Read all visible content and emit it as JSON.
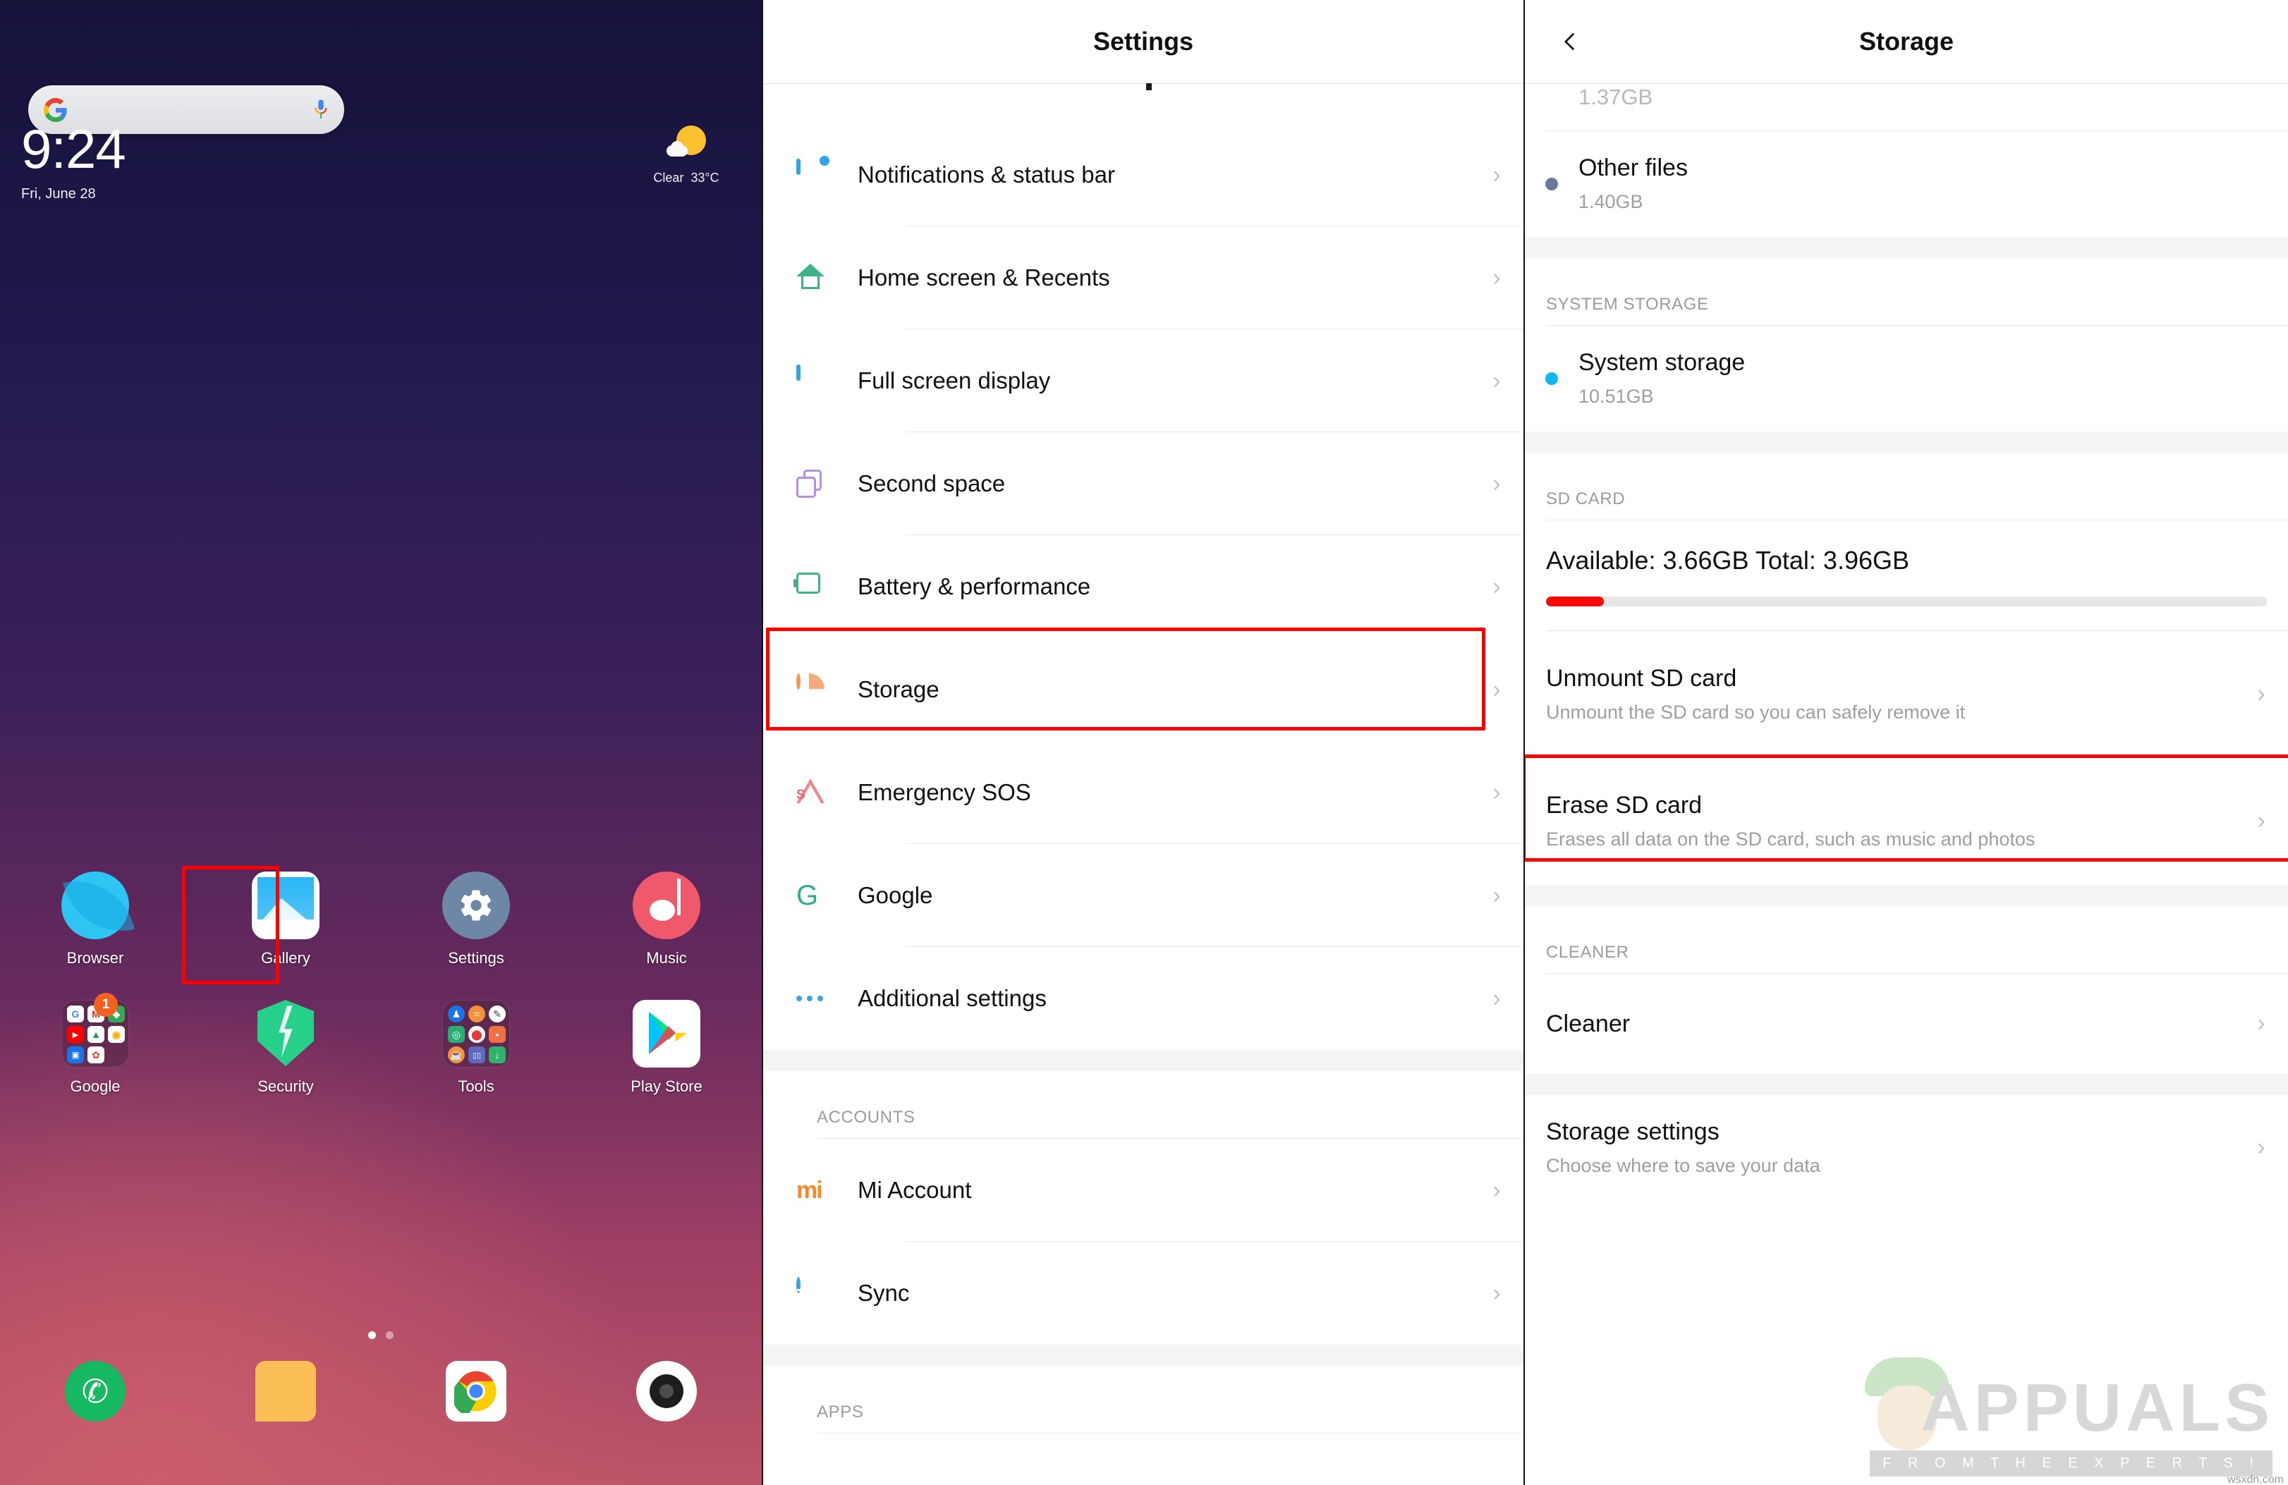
{
  "home": {
    "search": {
      "placeholder": "",
      "google_icon": "google-g-icon",
      "mic_icon": "microphone-icon"
    },
    "clock": {
      "time": "9:24",
      "date": "Fri, June 28"
    },
    "weather": {
      "condition": "Clear",
      "temperature": "33°C",
      "icon": "sun-behind-cloud-icon"
    },
    "apps": [
      {
        "label": "Browser",
        "icon": "browser-icon"
      },
      {
        "label": "Gallery",
        "icon": "gallery-icon"
      },
      {
        "label": "Settings",
        "icon": "settings-gear-icon",
        "highlighted": true
      },
      {
        "label": "Music",
        "icon": "music-note-icon"
      },
      {
        "label": "Google",
        "icon": "google-folder-icon",
        "badge": "1"
      },
      {
        "label": "Security",
        "icon": "security-shield-icon"
      },
      {
        "label": "Tools",
        "icon": "tools-folder-icon"
      },
      {
        "label": "Play Store",
        "icon": "play-store-icon"
      }
    ],
    "dock": [
      {
        "label": "Phone",
        "icon": "phone-icon"
      },
      {
        "label": "Messaging",
        "icon": "message-bubble-icon"
      },
      {
        "label": "Chrome",
        "icon": "chrome-icon"
      },
      {
        "label": "Camera",
        "icon": "camera-icon"
      }
    ],
    "page_indicator": {
      "total": 2,
      "current": 1
    }
  },
  "settings": {
    "title": "Settings",
    "items": [
      {
        "label": "Notifications & status bar",
        "icon": "notification-icon"
      },
      {
        "label": "Home screen & Recents",
        "icon": "home-icon"
      },
      {
        "label": "Full screen display",
        "icon": "fullscreen-phone-icon"
      },
      {
        "label": "Second space",
        "icon": "second-space-icon"
      },
      {
        "label": "Battery & performance",
        "icon": "battery-icon"
      },
      {
        "label": "Storage",
        "icon": "storage-pie-icon",
        "highlighted": true
      },
      {
        "label": "Emergency SOS",
        "icon": "sos-triangle-icon"
      },
      {
        "label": "Google",
        "icon": "google-g-icon"
      },
      {
        "label": "Additional settings",
        "icon": "more-dots-icon"
      }
    ],
    "accounts_header": "ACCOUNTS",
    "accounts": [
      {
        "label": "Mi Account",
        "icon": "mi-logo-icon"
      },
      {
        "label": "Sync",
        "icon": "sync-icon"
      }
    ],
    "apps_header": "APPS"
  },
  "storage": {
    "title": "Storage",
    "back_icon": "chevron-left-icon",
    "partial_top_value": "1.37GB",
    "categories": [
      {
        "label": "Other files",
        "value": "1.40GB",
        "color": "#6b7a99"
      }
    ],
    "system_header": "SYSTEM STORAGE",
    "system": [
      {
        "label": "System storage",
        "value": "10.51GB",
        "color": "#12b6f0"
      }
    ],
    "sd_header": "SD CARD",
    "sd_summary": "Available: 3.66GB  Total: 3.96GB",
    "sd_available": "3.66GB",
    "sd_total": "3.96GB",
    "sd_used_percent": 8,
    "sd_bar_color": "#fb0808",
    "actions": [
      {
        "label": "Unmount SD card",
        "sub": "Unmount the SD card so you can safely remove it",
        "highlighted": true
      },
      {
        "label": "Erase SD card",
        "sub": "Erases all data on the SD card, such as music and photos",
        "highlighted": false
      }
    ],
    "cleaner_header": "CLEANER",
    "cleaner": {
      "label": "Cleaner",
      "sub": ""
    },
    "storage_settings": {
      "label": "Storage settings",
      "sub": "Choose where to save your data"
    }
  },
  "watermark": {
    "brand": "APPUALS",
    "tagline": "F R O M   T H E   E X P E R T S !",
    "credit": "wsxdn.com"
  },
  "colors": {
    "highlight": "#ff0000",
    "accent_blue": "#30a4e0",
    "accent_orange": "#f2955a"
  }
}
